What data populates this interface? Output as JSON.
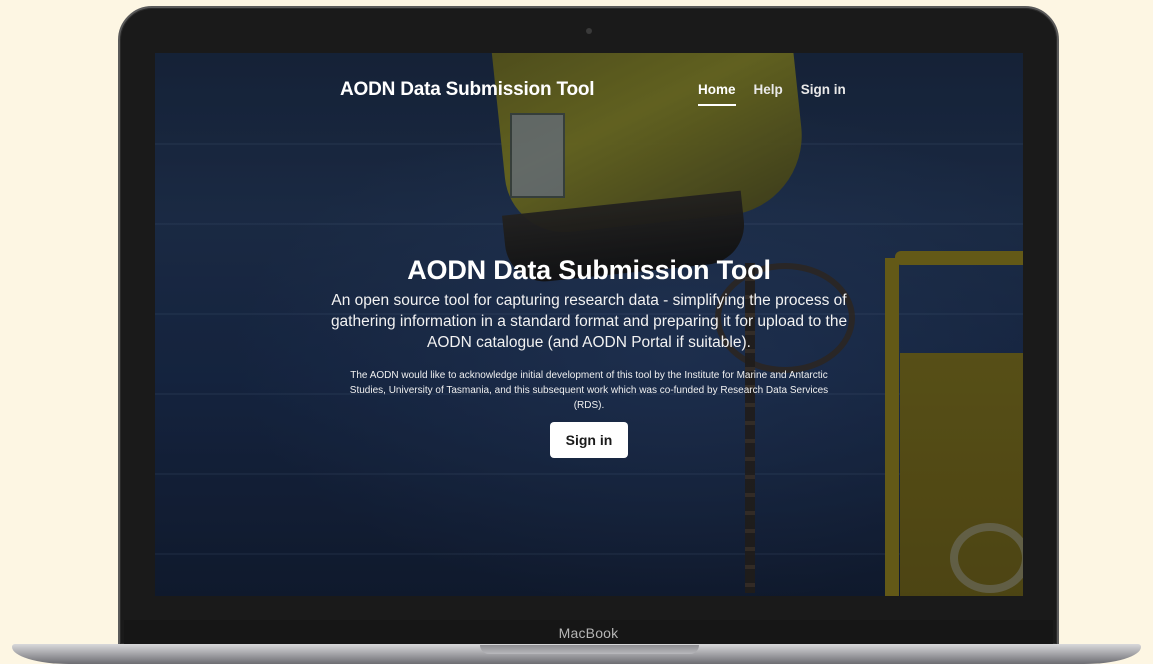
{
  "device": {
    "brand_label": "MacBook"
  },
  "navbar": {
    "site_title": "AODN Data Submission Tool",
    "links": [
      {
        "label": "Home",
        "active": true
      },
      {
        "label": "Help",
        "active": false
      },
      {
        "label": "Sign in",
        "active": false
      }
    ]
  },
  "hero": {
    "title": "AODN Data Submission Tool",
    "lead": "An open source tool for capturing research data - simplifying the process of gathering information in a standard format and preparing it for upload to the AODN catalogue (and AODN Portal if suitable).",
    "acknowledgement": "The AODN would like to acknowledge initial development of this tool by the Institute for Marine and Antarctic Studies, University of Tasmania, and this subsequent work which was co-funded by Research Data Services (RDS).",
    "button_label": "Sign in"
  },
  "colors": {
    "page_background": "#fdf6e3",
    "ocean": "#1b2d4f",
    "buoy_yellow": "#8e8a22",
    "button_bg": "#ffffff",
    "text": "#ffffff"
  }
}
